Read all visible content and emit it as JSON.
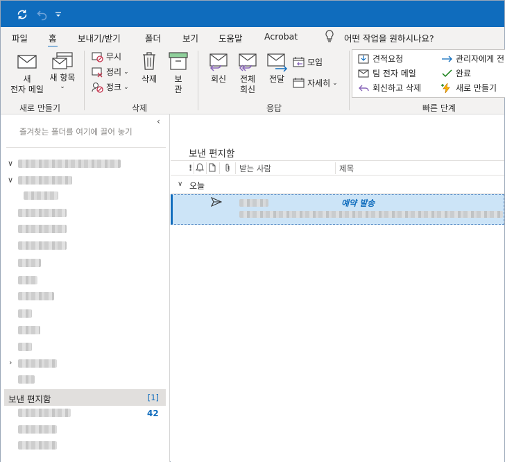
{
  "quick_access": {
    "refresh_icon": "sync-icon",
    "undo_icon": "undo-icon",
    "customize_icon": "customize-quick-access-icon"
  },
  "tabs": [
    {
      "label": "파일"
    },
    {
      "label": "홈"
    },
    {
      "label": "보내기/받기"
    },
    {
      "label": "폴더"
    },
    {
      "label": "보기"
    },
    {
      "label": "도움말"
    },
    {
      "label": "Acrobat"
    }
  ],
  "tell_me": {
    "text": "어떤 작업을 원하시나요?"
  },
  "ribbon": {
    "new": {
      "new_email_line1": "새",
      "new_email_line2": "전자 메일",
      "new_items_line1": "새 항목",
      "group_label": "새로 만들기"
    },
    "delete": {
      "ignore": "무시",
      "cleanup": "정리",
      "junk": "정크",
      "delete": "삭제",
      "archive_line1": "보",
      "archive_line2": "관",
      "group_label": "삭제"
    },
    "respond": {
      "reply": "회신",
      "reply_all_line1": "전체",
      "reply_all_line2": "회신",
      "forward": "전달",
      "meeting": "모임",
      "more": "자세히",
      "group_label": "응답"
    },
    "quick_steps": {
      "items": [
        {
          "label": "견적요청"
        },
        {
          "label": "관리자에게 전"
        },
        {
          "label": "팀 전자 메일"
        },
        {
          "label": "완료"
        },
        {
          "label": "회신하고 삭제"
        },
        {
          "label": "새로 만들기"
        }
      ],
      "group_label": "빠른 단계"
    }
  },
  "folder_pane": {
    "favorites_hint": "즐겨찾는 폴더를 여기에 끌어 놓기",
    "selected_folder": {
      "name": "보낸 편지함",
      "count": "[1]"
    },
    "unread_badge": "42"
  },
  "message_list": {
    "title": "보낸 편지함",
    "columns": {
      "to": "받는 사람",
      "subject": "제목"
    },
    "group": "오늘",
    "message": {
      "subject": "예약 발송"
    }
  },
  "colors": {
    "accent": "#0f6cbd",
    "selected_row": "#cce4f7",
    "ribbon_bg": "#f3f2f1"
  }
}
